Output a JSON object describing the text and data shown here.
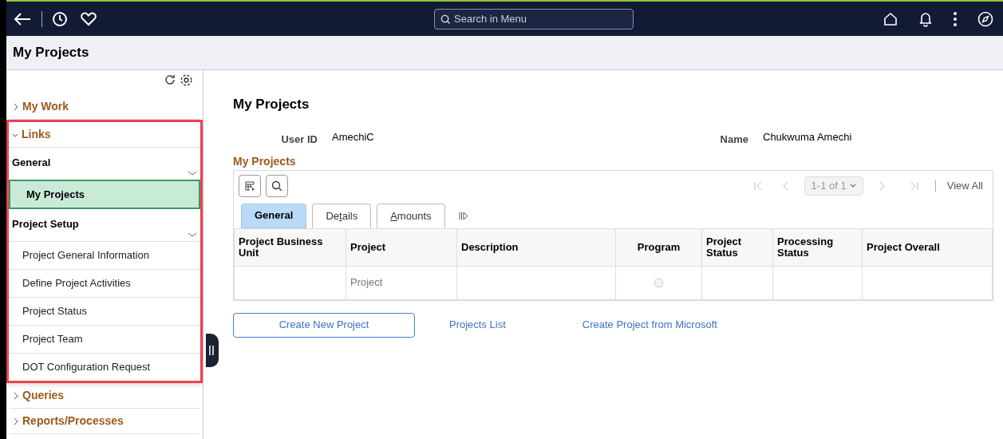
{
  "top_bar": {
    "search": {
      "placeholder": "Search in Menu"
    }
  },
  "page_title": "My Projects",
  "sidebar": {
    "sections": [
      {
        "label": "My Work",
        "expanded": false
      },
      {
        "label": "Links",
        "expanded": true,
        "highlighted": true,
        "groups": [
          {
            "label": "General",
            "items": [
              {
                "label": "My Projects",
                "selected": true
              }
            ]
          },
          {
            "label": "Project Setup",
            "items": [
              {
                "label": "Project General Information",
                "selected": false
              },
              {
                "label": "Define Project Activities",
                "selected": false
              },
              {
                "label": "Project Status",
                "selected": false
              },
              {
                "label": "Project Team",
                "selected": false
              },
              {
                "label": "DOT Configuration Request",
                "selected": false
              }
            ]
          }
        ]
      },
      {
        "label": "Queries",
        "expanded": false
      },
      {
        "label": "Reports/Processes",
        "expanded": false
      }
    ]
  },
  "main": {
    "heading": "My Projects",
    "fields": [
      {
        "label": "User ID",
        "value": "AmechiC"
      },
      {
        "label": "Name",
        "value": "Chukwuma Amechi"
      }
    ],
    "grid": {
      "title": "My Projects",
      "pager": "1-1 of 1",
      "view_all": "View All",
      "tabs": [
        {
          "before": "General",
          "selected": true
        },
        {
          "before": "De",
          "key": "t",
          "after": "ails",
          "selected": false
        },
        {
          "key": "A",
          "after": "mounts",
          "selected": false
        }
      ],
      "columns": [
        "Project Business Unit",
        "Project",
        "Description",
        "Program",
        "Project Status",
        "Processing Status",
        "Project Overall"
      ],
      "rows": [
        {
          "project": "Project",
          "program_checked": false
        }
      ]
    },
    "actions": [
      {
        "label": "Create New Project",
        "kind": "button"
      },
      {
        "label": "Projects List",
        "kind": "link"
      },
      {
        "label": "Create Project from Microsoft",
        "kind": "link"
      }
    ]
  }
}
